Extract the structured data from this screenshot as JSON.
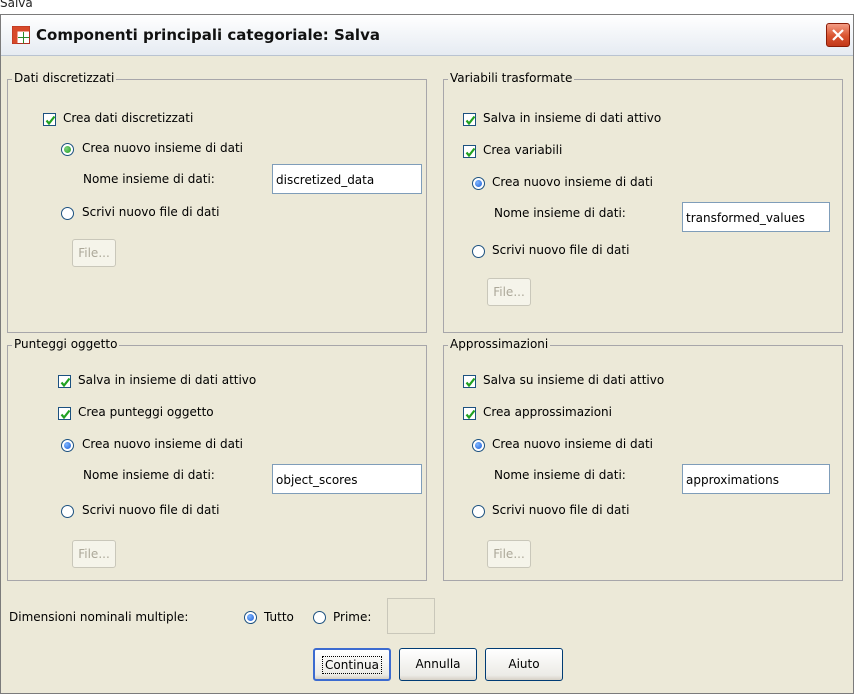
{
  "top_label": "Salva",
  "window": {
    "title": "Componenti principali categoriale: Salva"
  },
  "groups": {
    "dati_discretizzati": {
      "title": "Dati discretizzati",
      "create_checkbox": "Crea dati discretizzati",
      "new_dataset_radio": "Crea nuovo insieme di dati",
      "dataset_name_label": "Nome insieme di dati:",
      "dataset_name_value": "discretized_data",
      "write_file_radio": "Scrivi nuovo file di dati",
      "file_button": "File..."
    },
    "variabili_trasformate": {
      "title": "Variabili trasformate",
      "save_active_checkbox": "Salva in insieme di dati attivo",
      "create_checkbox": "Crea variabili",
      "new_dataset_radio": "Crea nuovo insieme di dati",
      "dataset_name_label": "Nome insieme di dati:",
      "dataset_name_value": "transformed_values",
      "write_file_radio": "Scrivi nuovo file di dati",
      "file_button": "File..."
    },
    "punteggi_oggetto": {
      "title": "Punteggi oggetto",
      "save_active_checkbox": "Salva in insieme di dati attivo",
      "create_checkbox": "Crea punteggi oggetto",
      "new_dataset_radio": "Crea nuovo insieme di dati",
      "dataset_name_label": "Nome insieme di dati:",
      "dataset_name_value": "object_scores",
      "write_file_radio": "Scrivi nuovo file di dati",
      "file_button": "File..."
    },
    "approssimazioni": {
      "title": "Approssimazioni",
      "save_active_checkbox": "Salva su insieme di dati attivo",
      "create_checkbox": "Crea approssimazioni",
      "new_dataset_radio": "Crea nuovo insieme di dati",
      "dataset_name_label": "Nome insieme di dati:",
      "dataset_name_value": "approximations",
      "write_file_radio": "Scrivi nuovo file di dati",
      "file_button": "File..."
    }
  },
  "multiple_nominal": {
    "label": "Dimensioni nominali multiple:",
    "option_all": "Tutto",
    "option_first": "Prime:"
  },
  "buttons": {
    "continue": "Continua",
    "cancel": "Annulla",
    "help": "Aiuto"
  },
  "colors": {
    "dialog_bg": "#ece9d8",
    "check_mark": "#21a121",
    "close_button": "#d9532f"
  }
}
